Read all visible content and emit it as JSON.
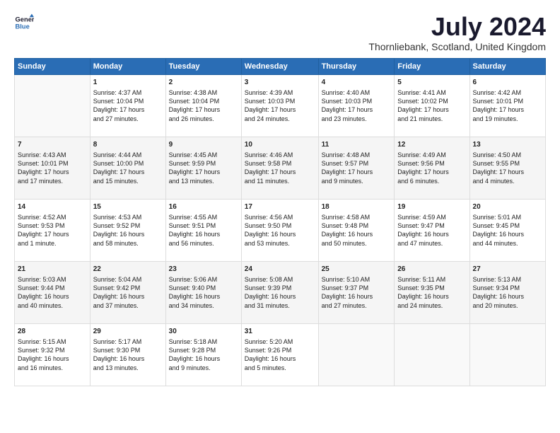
{
  "logo": {
    "line1": "General",
    "line2": "Blue"
  },
  "title": "July 2024",
  "location": "Thornliebank, Scotland, United Kingdom",
  "days_header": [
    "Sunday",
    "Monday",
    "Tuesday",
    "Wednesday",
    "Thursday",
    "Friday",
    "Saturday"
  ],
  "weeks": [
    [
      {
        "day": "",
        "content": ""
      },
      {
        "day": "1",
        "content": "Sunrise: 4:37 AM\nSunset: 10:04 PM\nDaylight: 17 hours\nand 27 minutes."
      },
      {
        "day": "2",
        "content": "Sunrise: 4:38 AM\nSunset: 10:04 PM\nDaylight: 17 hours\nand 26 minutes."
      },
      {
        "day": "3",
        "content": "Sunrise: 4:39 AM\nSunset: 10:03 PM\nDaylight: 17 hours\nand 24 minutes."
      },
      {
        "day": "4",
        "content": "Sunrise: 4:40 AM\nSunset: 10:03 PM\nDaylight: 17 hours\nand 23 minutes."
      },
      {
        "day": "5",
        "content": "Sunrise: 4:41 AM\nSunset: 10:02 PM\nDaylight: 17 hours\nand 21 minutes."
      },
      {
        "day": "6",
        "content": "Sunrise: 4:42 AM\nSunset: 10:01 PM\nDaylight: 17 hours\nand 19 minutes."
      }
    ],
    [
      {
        "day": "7",
        "content": "Sunrise: 4:43 AM\nSunset: 10:01 PM\nDaylight: 17 hours\nand 17 minutes."
      },
      {
        "day": "8",
        "content": "Sunrise: 4:44 AM\nSunset: 10:00 PM\nDaylight: 17 hours\nand 15 minutes."
      },
      {
        "day": "9",
        "content": "Sunrise: 4:45 AM\nSunset: 9:59 PM\nDaylight: 17 hours\nand 13 minutes."
      },
      {
        "day": "10",
        "content": "Sunrise: 4:46 AM\nSunset: 9:58 PM\nDaylight: 17 hours\nand 11 minutes."
      },
      {
        "day": "11",
        "content": "Sunrise: 4:48 AM\nSunset: 9:57 PM\nDaylight: 17 hours\nand 9 minutes."
      },
      {
        "day": "12",
        "content": "Sunrise: 4:49 AM\nSunset: 9:56 PM\nDaylight: 17 hours\nand 6 minutes."
      },
      {
        "day": "13",
        "content": "Sunrise: 4:50 AM\nSunset: 9:55 PM\nDaylight: 17 hours\nand 4 minutes."
      }
    ],
    [
      {
        "day": "14",
        "content": "Sunrise: 4:52 AM\nSunset: 9:53 PM\nDaylight: 17 hours\nand 1 minute."
      },
      {
        "day": "15",
        "content": "Sunrise: 4:53 AM\nSunset: 9:52 PM\nDaylight: 16 hours\nand 58 minutes."
      },
      {
        "day": "16",
        "content": "Sunrise: 4:55 AM\nSunset: 9:51 PM\nDaylight: 16 hours\nand 56 minutes."
      },
      {
        "day": "17",
        "content": "Sunrise: 4:56 AM\nSunset: 9:50 PM\nDaylight: 16 hours\nand 53 minutes."
      },
      {
        "day": "18",
        "content": "Sunrise: 4:58 AM\nSunset: 9:48 PM\nDaylight: 16 hours\nand 50 minutes."
      },
      {
        "day": "19",
        "content": "Sunrise: 4:59 AM\nSunset: 9:47 PM\nDaylight: 16 hours\nand 47 minutes."
      },
      {
        "day": "20",
        "content": "Sunrise: 5:01 AM\nSunset: 9:45 PM\nDaylight: 16 hours\nand 44 minutes."
      }
    ],
    [
      {
        "day": "21",
        "content": "Sunrise: 5:03 AM\nSunset: 9:44 PM\nDaylight: 16 hours\nand 40 minutes."
      },
      {
        "day": "22",
        "content": "Sunrise: 5:04 AM\nSunset: 9:42 PM\nDaylight: 16 hours\nand 37 minutes."
      },
      {
        "day": "23",
        "content": "Sunrise: 5:06 AM\nSunset: 9:40 PM\nDaylight: 16 hours\nand 34 minutes."
      },
      {
        "day": "24",
        "content": "Sunrise: 5:08 AM\nSunset: 9:39 PM\nDaylight: 16 hours\nand 31 minutes."
      },
      {
        "day": "25",
        "content": "Sunrise: 5:10 AM\nSunset: 9:37 PM\nDaylight: 16 hours\nand 27 minutes."
      },
      {
        "day": "26",
        "content": "Sunrise: 5:11 AM\nSunset: 9:35 PM\nDaylight: 16 hours\nand 24 minutes."
      },
      {
        "day": "27",
        "content": "Sunrise: 5:13 AM\nSunset: 9:34 PM\nDaylight: 16 hours\nand 20 minutes."
      }
    ],
    [
      {
        "day": "28",
        "content": "Sunrise: 5:15 AM\nSunset: 9:32 PM\nDaylight: 16 hours\nand 16 minutes."
      },
      {
        "day": "29",
        "content": "Sunrise: 5:17 AM\nSunset: 9:30 PM\nDaylight: 16 hours\nand 13 minutes."
      },
      {
        "day": "30",
        "content": "Sunrise: 5:18 AM\nSunset: 9:28 PM\nDaylight: 16 hours\nand 9 minutes."
      },
      {
        "day": "31",
        "content": "Sunrise: 5:20 AM\nSunset: 9:26 PM\nDaylight: 16 hours\nand 5 minutes."
      },
      {
        "day": "",
        "content": ""
      },
      {
        "day": "",
        "content": ""
      },
      {
        "day": "",
        "content": ""
      }
    ]
  ]
}
